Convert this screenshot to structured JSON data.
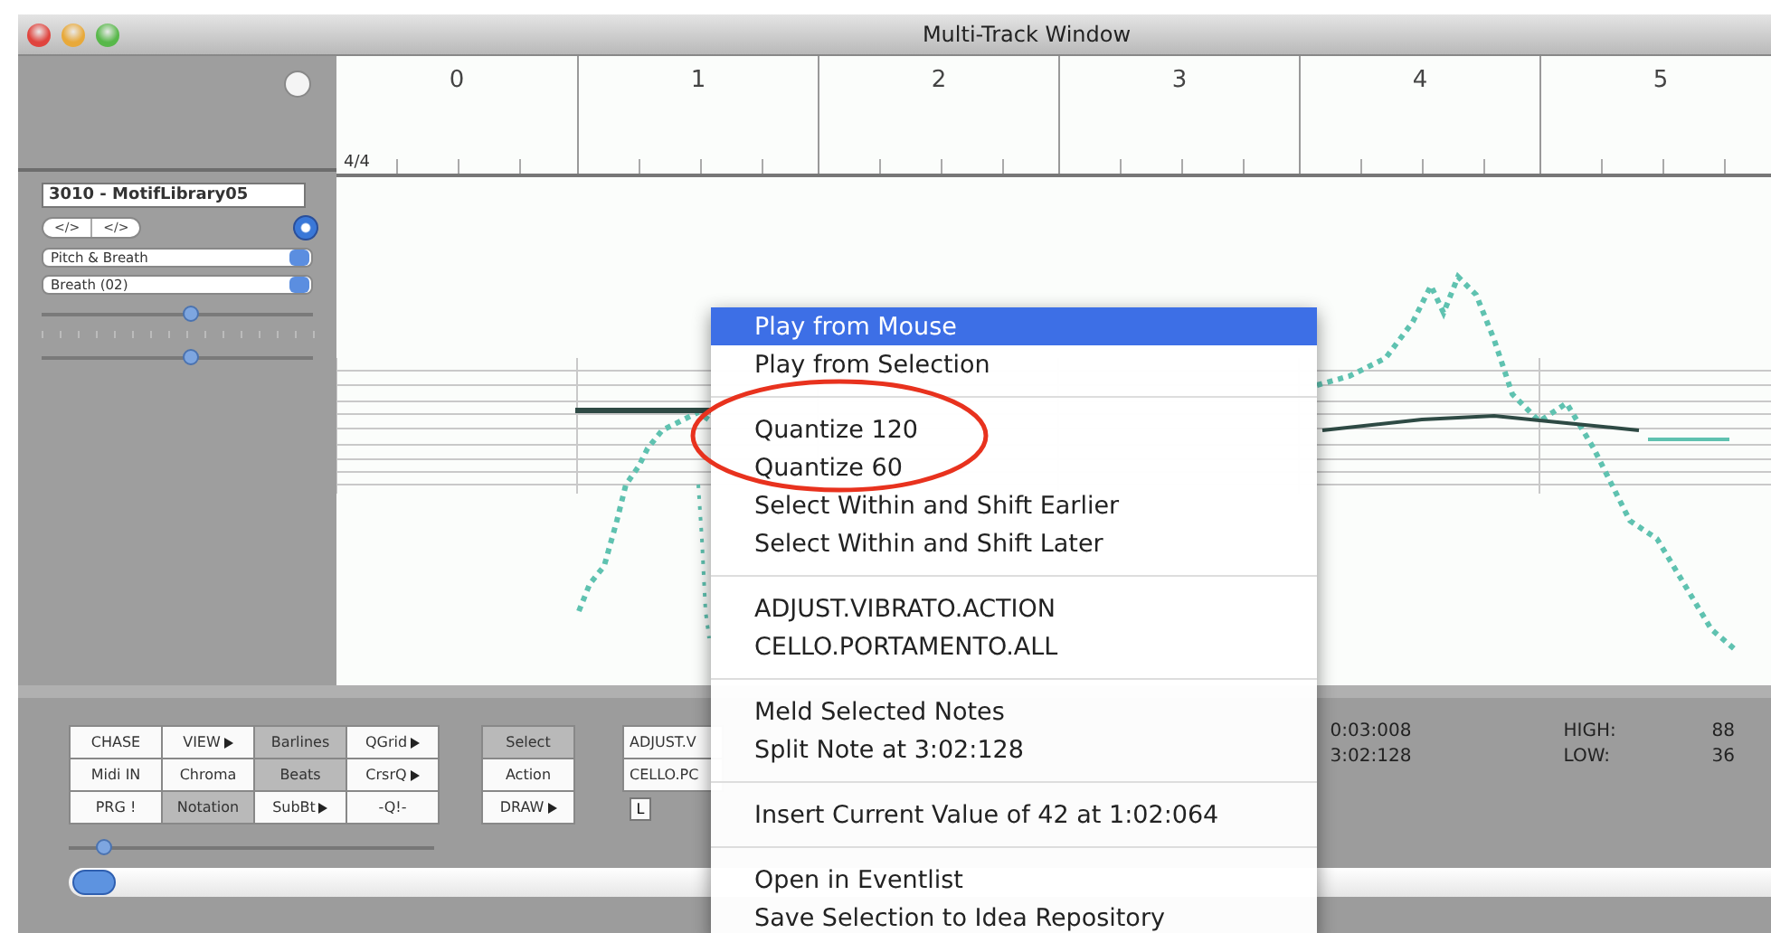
{
  "window": {
    "title": "Multi-Track Window"
  },
  "ruler": {
    "time_signature": "4/4",
    "bars": [
      "0",
      "1",
      "2",
      "3",
      "4",
      "5"
    ]
  },
  "track": {
    "name": "3010 - MotifLibrary05",
    "segments": [
      "</>",
      "</>"
    ],
    "radio": {
      "selected": true
    },
    "popups": [
      "Pitch & Breath",
      "Breath (02)"
    ],
    "sliders": [
      {
        "level": 0.55
      },
      {
        "level": 0.55
      }
    ]
  },
  "toolbar": {
    "grid": [
      [
        {
          "label": "CHASE",
          "selected": false,
          "has_menu": false
        },
        {
          "label": "VIEW",
          "selected": false,
          "has_menu": true
        },
        {
          "label": "Barlines",
          "selected": true,
          "has_menu": false
        },
        {
          "label": "QGrid",
          "selected": false,
          "has_menu": true
        }
      ],
      [
        {
          "label": "Midi IN",
          "selected": false,
          "has_menu": false
        },
        {
          "label": "Chroma",
          "selected": false,
          "has_menu": false
        },
        {
          "label": "Beats",
          "selected": true,
          "has_menu": false
        },
        {
          "label": "CrsrQ",
          "selected": false,
          "has_menu": true
        }
      ],
      [
        {
          "label": "PRG !",
          "selected": false,
          "has_menu": false
        },
        {
          "label": "Notation",
          "selected": true,
          "has_menu": false
        },
        {
          "label": "SubBt",
          "selected": false,
          "has_menu": true
        },
        {
          "label": "-Q!-",
          "selected": false,
          "has_menu": false
        }
      ]
    ],
    "modes": [
      {
        "label": "Select",
        "selected": true,
        "has_menu": false
      },
      {
        "label": "Action",
        "selected": false,
        "has_menu": false
      },
      {
        "label": "DRAW",
        "selected": false,
        "has_menu": true
      }
    ],
    "actions": [
      "ADJUST.V",
      "CELLO.PC"
    ],
    "l_button": "L",
    "slider": {
      "level": 0.1
    }
  },
  "readouts": [
    {
      "time": "0:03:008",
      "label": "HIGH:",
      "value": "88"
    },
    {
      "time": "3:02:128",
      "label": "LOW:",
      "value": "36"
    }
  ],
  "context_menu": {
    "groups": [
      [
        {
          "label": "Play from Mouse",
          "selected": true
        },
        {
          "label": "Play from Selection",
          "selected": false
        }
      ],
      [
        {
          "label": "Quantize 120",
          "selected": false
        },
        {
          "label": "Quantize 60",
          "selected": false
        },
        {
          "label": "Select Within and Shift Earlier",
          "selected": false
        },
        {
          "label": "Select Within and Shift Later",
          "selected": false
        }
      ],
      [
        {
          "label": "ADJUST.VIBRATO.ACTION",
          "selected": false
        },
        {
          "label": "CELLO.PORTAMENTO.ALL",
          "selected": false
        }
      ],
      [
        {
          "label": "Meld Selected Notes",
          "selected": false
        },
        {
          "label": "Split Note at 3:02:128",
          "selected": false
        }
      ],
      [
        {
          "label": "Insert Current Value of 42 at 1:02:064",
          "selected": false
        }
      ],
      [
        {
          "label": "Open in Eventlist",
          "selected": false
        },
        {
          "label": "Save Selection to Idea Repository",
          "selected": false
        }
      ]
    ]
  }
}
